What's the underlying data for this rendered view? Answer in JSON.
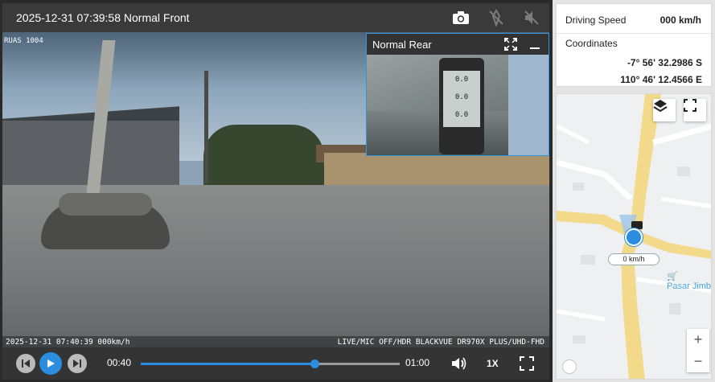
{
  "front": {
    "title": "2025-12-31 07:39:58 Normal Front",
    "osd_top": "RUAS 1004",
    "osd_bottom_left": "2025-12-31 07:40:39 000km/h",
    "osd_bottom_right": "LIVE/MIC OFF/HDR BLACKVUE DR970X PLUS/UHD-FHD"
  },
  "toolbar": {
    "icons": [
      "camera-icon",
      "no-gps-icon",
      "mute-icon"
    ]
  },
  "rear": {
    "label": "Normal Rear",
    "gps_readings": [
      "0.0",
      "0.0",
      "0.0"
    ]
  },
  "controls": {
    "current_time": "00:40",
    "total_time": "01:00",
    "progress": 0.67,
    "playback_speed": "1X"
  },
  "info": {
    "speed_label": "Driving Speed",
    "speed_value": "000 km/h",
    "coords_label": "Coordinates",
    "latitude": "-7° 56' 32.2986 S",
    "longitude": "110° 46' 12.4566 E"
  },
  "map": {
    "speed_pill": "0 km/h",
    "poi_label": "Pasar Jimb",
    "zoom_in": "+",
    "zoom_out": "−",
    "road_color": "#f3d98a",
    "water_color": "#c7dbf0"
  },
  "colors": {
    "accent": "#2b8de0"
  }
}
